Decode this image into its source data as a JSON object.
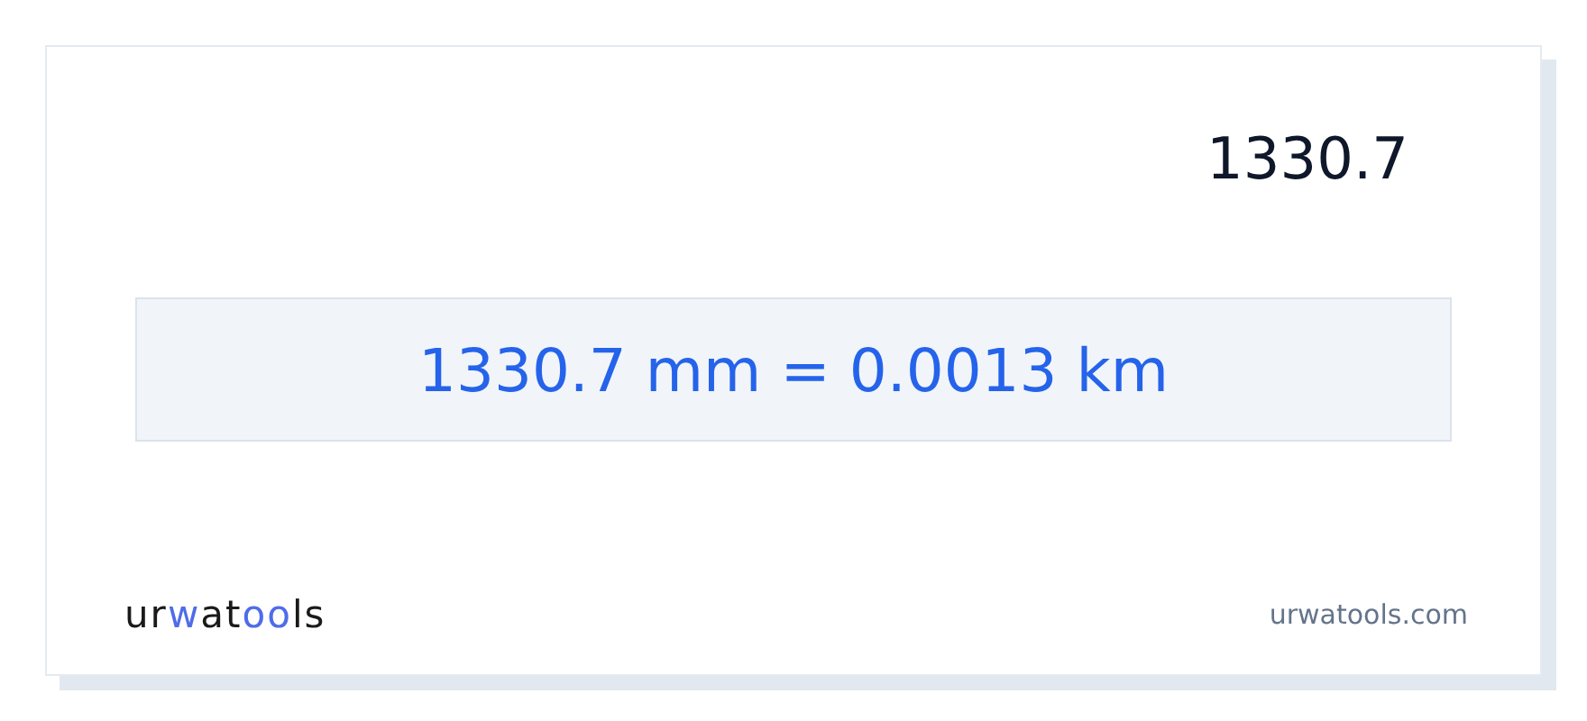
{
  "input_value": "1330.7",
  "result": "1330.7 mm = 0.0013 km",
  "logo": [
    {
      "text": "ur",
      "kind": "plain"
    },
    {
      "text": "w",
      "kind": "accent"
    },
    {
      "text": "at",
      "kind": "plain"
    },
    {
      "text": "oo",
      "kind": "accent"
    },
    {
      "text": "ls",
      "kind": "plain"
    }
  ],
  "site": "urwatools.com"
}
